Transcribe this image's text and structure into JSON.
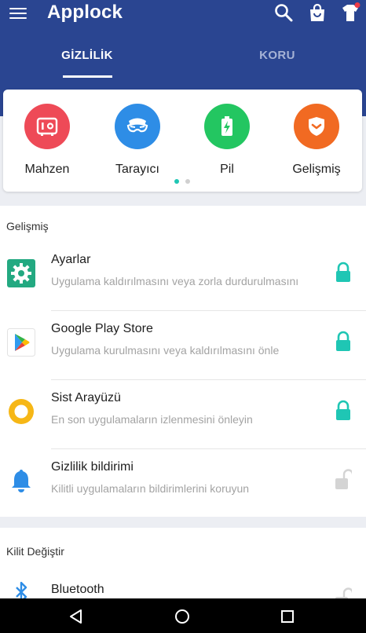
{
  "app": {
    "title": "Applock"
  },
  "tabs": [
    {
      "label": "GİZLİLİK",
      "active": true
    },
    {
      "label": "KORU",
      "active": false
    }
  ],
  "features": [
    {
      "label": "Mahzen",
      "icon": "vault-icon",
      "color": "#ee4a57"
    },
    {
      "label": "Tarayıcı",
      "icon": "incognito-mask-icon",
      "color": "#2e8de6"
    },
    {
      "label": "Pil",
      "icon": "battery-icon",
      "color": "#23c661"
    },
    {
      "label": "Gelişmiş",
      "icon": "shield-icon",
      "color": "#f16a22"
    }
  ],
  "carousel": {
    "total_pages": 2,
    "current_page": 1,
    "active_color": "#1fc6b4",
    "inactive_color": "#d0d0d0"
  },
  "sections": [
    {
      "title": "Gelişmiş",
      "items": [
        {
          "name": "Ayarlar",
          "desc": "Uygulama kaldırılmasını veya zorla durdurulmasını",
          "icon": "settings-gear-icon",
          "locked": true
        },
        {
          "name": "Google Play Store",
          "desc": "Uygulama kurulmasını veya kaldırılmasını önle",
          "icon": "play-store-icon",
          "locked": true
        },
        {
          "name": "Sist Arayüzü",
          "desc": "En son uygulamaların izlenmesini önleyin",
          "icon": "system-ui-icon",
          "locked": true
        },
        {
          "name": "Gizlilik bildirimi",
          "desc": "Kilitli uygulamaların bildirimlerini koruyun",
          "icon": "notification-bell-icon",
          "locked": false
        }
      ]
    },
    {
      "title": "Kilit Değiştir",
      "items": [
        {
          "name": "Bluetooth",
          "icon": "bluetooth-icon",
          "locked": false
        }
      ]
    }
  ],
  "colors": {
    "header": "#2a4591",
    "lock_active": "#1fc6b4",
    "lock_inactive": "#d4d4d4",
    "background": "#eceef3"
  }
}
